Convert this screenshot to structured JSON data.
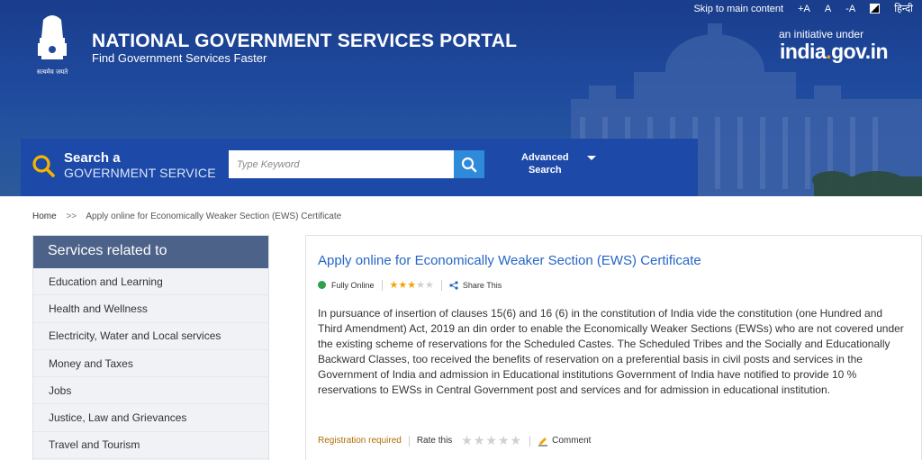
{
  "topbar": {
    "skip": "Skip to main content",
    "font_increase": "+A",
    "font_normal": "A",
    "font_decrease": "-A",
    "language": "हिन्दी"
  },
  "header": {
    "emblem_motto": "सत्यमेव जयते",
    "title": "NATIONAL GOVERNMENT SERVICES PORTAL",
    "subtitle": "Find Government Services Faster",
    "initiative": "an initiative under",
    "india_gov_a": "india",
    "india_gov_dot": ".",
    "india_gov_b": "gov.in"
  },
  "search": {
    "title": "Search a",
    "subtitle": "GOVERNMENT SERVICE",
    "placeholder": "Type Keyword",
    "advanced_line1": "Advanced",
    "advanced_line2": "Search"
  },
  "breadcrumb": {
    "home": "Home",
    "separator": ">>",
    "current": "Apply online for Economically Weaker Section (EWS) Certificate"
  },
  "sidebar": {
    "heading": "Services related to",
    "items": [
      {
        "label": "Education and Learning"
      },
      {
        "label": "Health and Wellness"
      },
      {
        "label": "Electricity, Water and Local services"
      },
      {
        "label": "Money and Taxes"
      },
      {
        "label": "Jobs"
      },
      {
        "label": "Justice, Law and Grievances"
      },
      {
        "label": "Travel and Tourism"
      }
    ]
  },
  "service": {
    "title": "Apply online for Economically Weaker Section (EWS) Certificate",
    "status": "Fully Online",
    "status_color": "#2da24a",
    "rating": 3,
    "rating_max": 5,
    "share": "Share This",
    "description": "In pursuance of insertion of clauses 15(6) and 16 (6) in the constitution of India vide the constitution (one Hundred and Third Amendment) Act, 2019 an din order to enable the Economically Weaker Sections (EWSs) who are not covered under the existing scheme of reservations for the Scheduled Castes. The Scheduled Tribes and the Socially and Educationally Backward Classes, too received the benefits of reservation on a preferential basis in civil posts and services in the Government of India and admission in Educational institutions Government of India have notified to provide 10 % reservations to EWSs in Central Government post and services and for admission in educational institution.",
    "registration": "Registration required",
    "rate_label": "Rate this",
    "comment": "Comment"
  },
  "colors": {
    "header_blue": "#1f4a9e",
    "search_blue": "#1d4aa8",
    "link_blue": "#2565c7",
    "sidebar_head": "#4d6288",
    "star_gold": "#f0a500",
    "registration_orange": "#b26b00"
  }
}
